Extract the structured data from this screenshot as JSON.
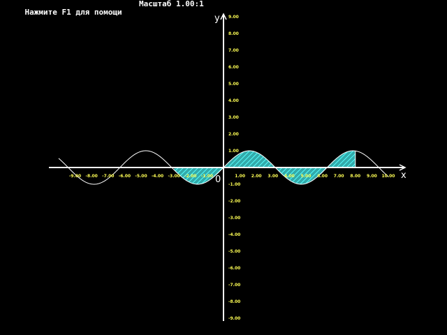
{
  "status": {
    "help_hint": "Нажмите F1 для помощи",
    "scale_text": "Масштаб 1.00:1"
  },
  "colors": {
    "background": "#000000",
    "axis": "#ffffff",
    "curve": "#ffffff",
    "tick_label": "#ffff55",
    "fill": "#33aaaa",
    "hatch": "#55ffff"
  },
  "chart_data": {
    "type": "line",
    "function": "sin(x)",
    "x_axis_label": "x",
    "y_axis_label": "y",
    "origin_label": "0",
    "xlim": [
      -10,
      11
    ],
    "ylim": [
      -9,
      9
    ],
    "curve_domain": [
      -10,
      10
    ],
    "shaded_region": {
      "from": -3,
      "to": 8,
      "pattern": "diagonal-hatch"
    },
    "x_ticks": [
      -9,
      -8,
      -7,
      -6,
      -5,
      -4,
      -3,
      -2,
      -1,
      1,
      2,
      3,
      4,
      5,
      6,
      7,
      8,
      9,
      10
    ],
    "x_tick_labels": [
      "-9.00",
      "-8.00",
      "-7.00",
      "-6.00",
      "-5.00",
      "-4.00",
      "-3.00",
      "-2.00",
      "-1.00",
      "1.00",
      "2.00",
      "3.00",
      "4.00",
      "5.00",
      "6.00",
      "7.00",
      "8.00",
      "9.00",
      "10.00"
    ],
    "y_ticks": [
      9,
      8,
      7,
      6,
      5,
      4,
      3,
      2,
      1,
      -1,
      -2,
      -3,
      -4,
      -5,
      -6,
      -7,
      -8,
      -9
    ],
    "y_tick_labels": [
      "9.00",
      "8.00",
      "7.00",
      "6.00",
      "5.00",
      "4.00",
      "3.00",
      "2.00",
      "1.00",
      "-1.00",
      "-2.00",
      "-3.00",
      "-4.00",
      "-5.00",
      "-6.00",
      "-7.00",
      "-8.00",
      "-9.00"
    ]
  }
}
